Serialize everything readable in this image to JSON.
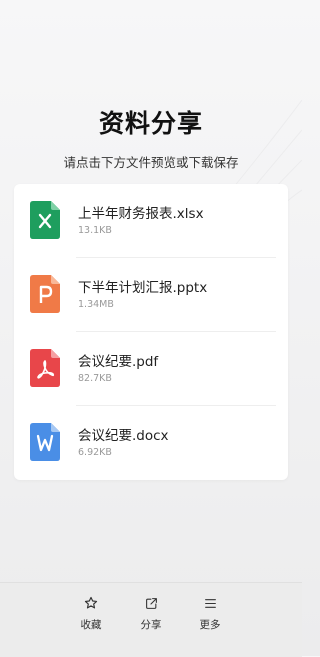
{
  "page": {
    "title": "资料分享",
    "subtitle": "请点击下方文件预览或下载保存"
  },
  "files": [
    {
      "name": "上半年财务报表.xlsx",
      "size": "13.1KB",
      "type": "xlsx",
      "icon": "excel-file-icon",
      "color": "#1e9e5e"
    },
    {
      "name": "下半年计划汇报.pptx",
      "size": "1.34MB",
      "type": "pptx",
      "icon": "powerpoint-file-icon",
      "color": "#f07a47"
    },
    {
      "name": "会议纪要.pdf",
      "size": "82.7KB",
      "type": "pdf",
      "icon": "pdf-file-icon",
      "color": "#e8464a"
    },
    {
      "name": "会议纪要.docx",
      "size": "6.92KB",
      "type": "docx",
      "icon": "word-file-icon",
      "color": "#4a8ee6"
    }
  ],
  "bottom_bar": {
    "favorite": {
      "label": "收藏",
      "icon": "star-icon"
    },
    "share": {
      "label": "分享",
      "icon": "share-icon"
    },
    "more": {
      "label": "更多",
      "icon": "menu-icon"
    }
  }
}
